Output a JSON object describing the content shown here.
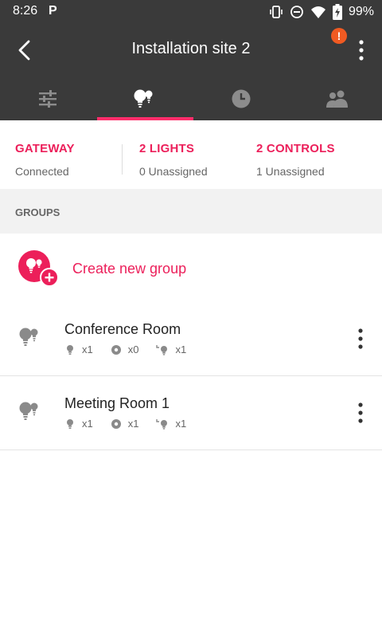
{
  "status_bar": {
    "time": "8:26",
    "notification_letter": "P",
    "battery": "99%",
    "icons": [
      "vibrate-icon",
      "do-not-disturb-icon",
      "wifi-icon",
      "battery-charging-icon"
    ]
  },
  "app_bar": {
    "title": "Installation site 2",
    "alert_badge": "!"
  },
  "tabs": [
    {
      "icon": "sliders-icon",
      "selected": false
    },
    {
      "icon": "bulbs-icon",
      "selected": true
    },
    {
      "icon": "clock-icon",
      "selected": false
    },
    {
      "icon": "users-icon",
      "selected": false
    }
  ],
  "summary": {
    "gateway": {
      "title": "GATEWAY",
      "subtitle": "Connected"
    },
    "lights": {
      "title": "2 LIGHTS",
      "subtitle": "0 Unassigned"
    },
    "controls": {
      "title": "2 CONTROLS",
      "subtitle": "1 Unassigned"
    }
  },
  "groups_header": "GROUPS",
  "create_group": {
    "label": "Create new group"
  },
  "groups": [
    {
      "name": "Conference Room",
      "lights": "x1",
      "sensors": "x0",
      "controls": "x1"
    },
    {
      "name": "Meeting Room 1",
      "lights": "x1",
      "sensors": "x1",
      "controls": "x1"
    }
  ],
  "colors": {
    "accent": "#ec1f5a",
    "toolbar": "#3a3a3a",
    "alert": "#f05a22",
    "icon_gray": "#8a8a8a"
  }
}
